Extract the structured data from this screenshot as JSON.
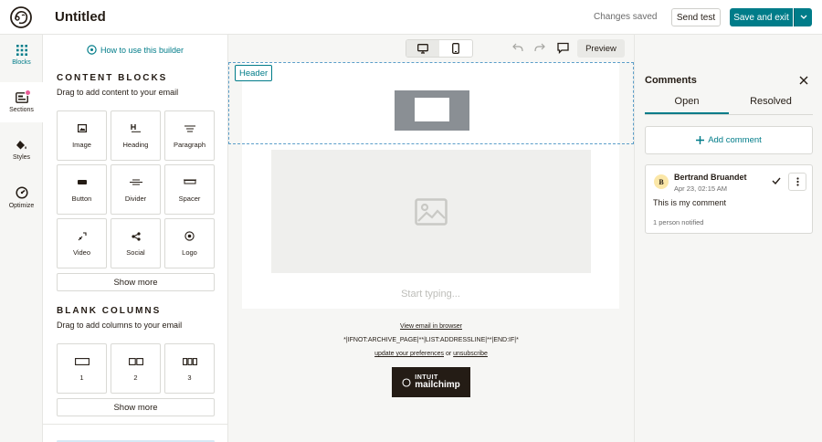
{
  "app": {
    "title": "Untitled",
    "status": "Changes saved",
    "send_test": "Send test",
    "save_exit": "Save and exit"
  },
  "rail": {
    "items": [
      {
        "label": "Blocks",
        "icon": "grid-icon"
      },
      {
        "label": "Sections",
        "icon": "sections-icon"
      },
      {
        "label": "Styles",
        "icon": "paint-bucket-icon"
      },
      {
        "label": "Optimize",
        "icon": "gauge-icon"
      }
    ]
  },
  "panel": {
    "howto": "How to use this builder",
    "content": {
      "title": "CONTENT BLOCKS",
      "subtitle": "Drag to add content to your email",
      "blocks": [
        "Image",
        "Heading",
        "Paragraph",
        "Button",
        "Divider",
        "Spacer",
        "Video",
        "Social",
        "Logo"
      ],
      "show_more": "Show more"
    },
    "columns": {
      "title": "BLANK COLUMNS",
      "subtitle": "Drag to add columns to your email",
      "blocks": [
        "1",
        "2",
        "3"
      ],
      "show_more": "Show more"
    }
  },
  "toolbar": {
    "preview": "Preview"
  },
  "canvas": {
    "header_label": "Header",
    "start_typing": "Start typing...",
    "view_in_browser": "View email in browser",
    "merge_tags": "*|IFNOT:ARCHIVE_PAGE|**|LIST:ADDRESSLINE|**|END:IF|*",
    "update_prefs": "update your preferences",
    "or": "or",
    "unsubscribe": "unsubscribe",
    "brand_top": "INTUIT",
    "brand_bottom": "mailchimp"
  },
  "comments": {
    "title": "Comments",
    "tabs": [
      "Open",
      "Resolved"
    ],
    "add": "Add comment",
    "items": [
      {
        "initial": "B",
        "author": "Bertrand Bruandet",
        "date": "Apr 23, 02:15 AM",
        "body": "This is my comment",
        "notified": "1 person notified"
      }
    ]
  },
  "colors": {
    "accent": "#007c89",
    "badge": "#e85c96",
    "selection": "#5b9ec9"
  }
}
